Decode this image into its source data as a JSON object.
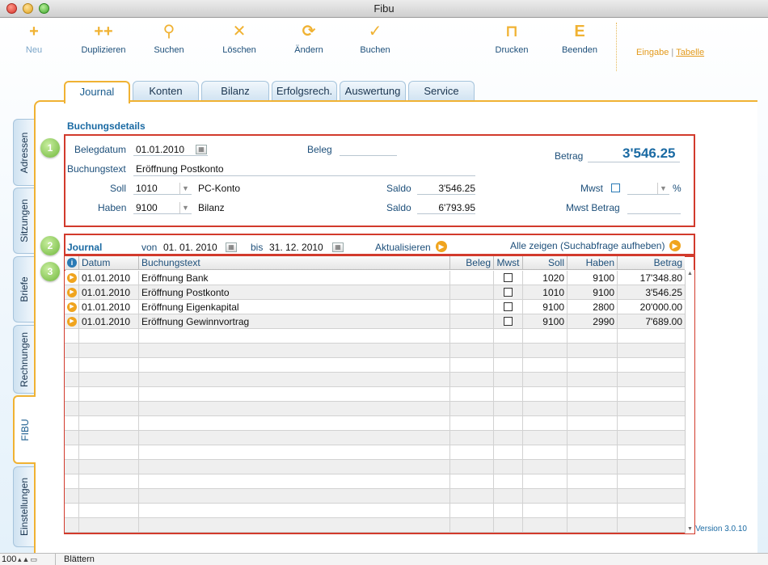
{
  "window": {
    "title": "Fibu"
  },
  "toolbar": {
    "buttons": [
      {
        "label": "Neu",
        "icon": "+"
      },
      {
        "label": "Duplizieren",
        "icon": "++"
      },
      {
        "label": "Suchen",
        "icon": "⚲"
      },
      {
        "label": "Löschen",
        "icon": "✕"
      },
      {
        "label": "Ändern",
        "icon": "⟳"
      },
      {
        "label": "Buchen",
        "icon": "✓"
      },
      {
        "label": "Drucken",
        "icon": "⊓"
      },
      {
        "label": "Beenden",
        "icon": "E"
      }
    ],
    "mode_input": "Eingabe",
    "mode_sep": "|",
    "mode_table": "Tabelle"
  },
  "tabs": [
    "Journal",
    "Konten",
    "Bilanz",
    "Erfolgsrech.",
    "Auswertung",
    "Service"
  ],
  "side_tabs": [
    "Adressen",
    "Sitzungen",
    "Briefe",
    "Rechnungen",
    "FIBU",
    "Einstellungen"
  ],
  "details": {
    "section_title": "Buchungsdetails",
    "badge1": "1",
    "belegdatum_label": "Belegdatum",
    "belegdatum": "01.01.2010",
    "beleg_label": "Beleg",
    "beleg": "",
    "betrag_label": "Betrag",
    "betrag": "3'546.25",
    "buchungstext_label": "Buchungstext",
    "buchungstext": "Eröffnung Postkonto",
    "soll_label": "Soll",
    "soll": "1010",
    "soll_name": "PC-Konto",
    "saldo_label": "Saldo",
    "soll_saldo": "3'546.25",
    "mwst_label": "Mwst",
    "mwst_unit": "%",
    "haben_label": "Haben",
    "haben": "9100",
    "haben_name": "Bilanz",
    "haben_saldo": "6'793.95",
    "mwst_betrag_label": "Mwst Betrag"
  },
  "journal": {
    "badge2": "2",
    "title": "Journal",
    "von_label": "von",
    "von": "01. 01. 2010",
    "bis_label": "bis",
    "bis": "31. 12. 2010",
    "refresh": "Aktualisieren",
    "show_all": "Alle zeigen (Suchabfrage aufheben)"
  },
  "table": {
    "badge3": "3",
    "info_icon": "i",
    "headers": [
      "Datum",
      "Buchungstext",
      "Beleg",
      "Mwst",
      "Soll",
      "Haben",
      "Betrag"
    ],
    "rows": [
      [
        "01.01.2010",
        "Eröffnung Bank",
        "",
        "",
        "1020",
        "9100",
        "17'348.80"
      ],
      [
        "01.01.2010",
        "Eröffnung Postkonto",
        "",
        "",
        "1010",
        "9100",
        "3'546.25"
      ],
      [
        "01.01.2010",
        "Eröffnung Eigenkapital",
        "",
        "",
        "9100",
        "2800",
        "20'000.00"
      ],
      [
        "01.01.2010",
        "Eröffnung Gewinnvortrag",
        "",
        "",
        "9100",
        "2990",
        "7'689.00"
      ]
    ]
  },
  "version": "Version 3.0.10",
  "status": {
    "zoom": "100",
    "mode": "Blättern"
  },
  "colors": {
    "accent": "#f0b233",
    "highlight": "#d23a2c",
    "link": "#1a6aa3"
  }
}
